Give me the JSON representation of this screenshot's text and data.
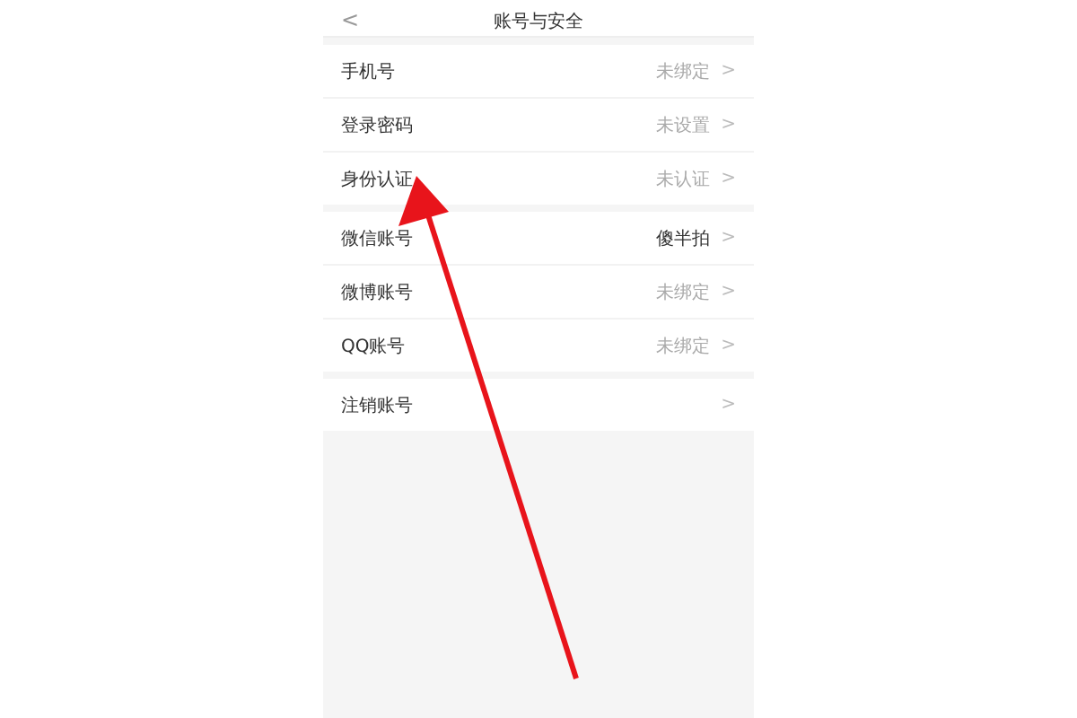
{
  "header": {
    "back": "<",
    "title": "账号与安全"
  },
  "groups": [
    {
      "rows": [
        {
          "label": "手机号",
          "value": "未绑定",
          "bound": false,
          "chevron": ">"
        },
        {
          "label": "登录密码",
          "value": "未设置",
          "bound": false,
          "chevron": ">"
        },
        {
          "label": "身份认证",
          "value": "未认证",
          "bound": false,
          "chevron": ">"
        }
      ]
    },
    {
      "rows": [
        {
          "label": "微信账号",
          "value": "傻半拍",
          "bound": true,
          "chevron": ">"
        },
        {
          "label": "微博账号",
          "value": "未绑定",
          "bound": false,
          "chevron": ">"
        },
        {
          "label": "QQ账号",
          "value": "未绑定",
          "bound": false,
          "chevron": ">"
        }
      ]
    },
    {
      "rows": [
        {
          "label": "注销账号",
          "chevron": ">"
        }
      ]
    }
  ]
}
